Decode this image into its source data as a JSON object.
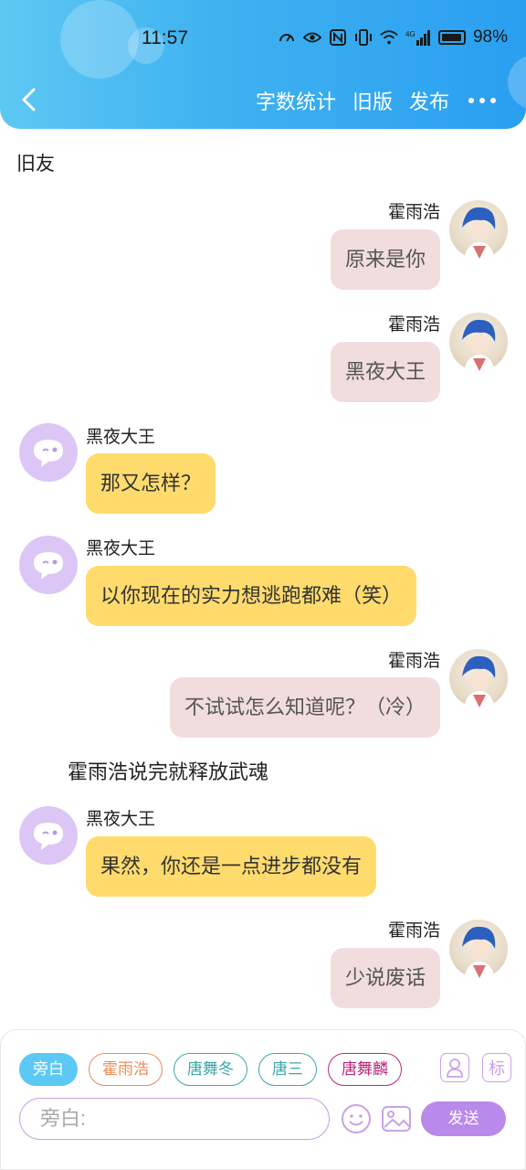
{
  "status": {
    "time": "11:57",
    "battery": "98%",
    "network": "4G"
  },
  "nav": {
    "word_count": "字数统计",
    "old_version": "旧版",
    "publish": "发布"
  },
  "chat": {
    "title": "旧友",
    "messages": [
      {
        "speaker": "霍雨浩",
        "text": "原来是你"
      },
      {
        "speaker": "霍雨浩",
        "text": "黑夜大王"
      },
      {
        "speaker": "黑夜大王",
        "text": "那又怎样？"
      },
      {
        "speaker": "黑夜大王",
        "text": "以你现在的实力想逃跑都难（笑）"
      },
      {
        "speaker": "霍雨浩",
        "text": "不试试怎么知道呢？（冷）"
      },
      {
        "speaker": "narration",
        "text": "霍雨浩说完就释放武魂"
      },
      {
        "speaker": "黑夜大王",
        "text": "果然，你还是一点进步都没有"
      },
      {
        "speaker": "霍雨浩",
        "text": "少说废话"
      }
    ]
  },
  "composer": {
    "characters": [
      "旁白",
      "霍雨浩",
      "唐舞冬",
      "唐三",
      "唐舞麟"
    ],
    "label_icon": "标",
    "input_placeholder": "旁白:",
    "send_label": "发送"
  },
  "colors": {
    "header": "#3fb2f0",
    "pink_bubble": "#f1dcde",
    "yellow_bubble": "#ffdb6d",
    "accent": "#b98ae9"
  }
}
